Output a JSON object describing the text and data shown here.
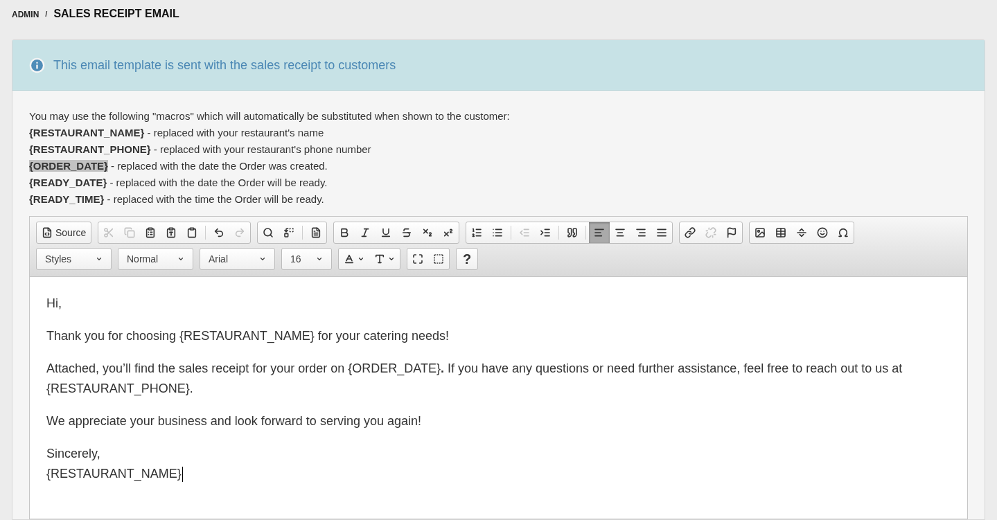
{
  "breadcrumb": {
    "parent": "ADMIN",
    "separator": "/",
    "title": "SALES RECEIPT EMAIL"
  },
  "info": {
    "text": "This email template is sent with the sales receipt to customers"
  },
  "intro": "You may use the following \"macros\" which will automatically be substituted when shown to the customer:",
  "macros": [
    {
      "macro": "{RESTAURANT_NAME}",
      "description": " - replaced with your restaurant's name",
      "highlighted": false
    },
    {
      "macro": "{RESTAURANT_PHONE}",
      "description": " - replaced with your restaurant's phone number",
      "highlighted": false
    },
    {
      "macro": "{ORDER_DATE}",
      "description": " - replaced with the date the Order was created.",
      "highlighted": true
    },
    {
      "macro": "{READY_DATE}",
      "description": " - replaced with the date the Order will be ready.",
      "highlighted": false
    },
    {
      "macro": "{READY_TIME}",
      "description": " - replaced with the time the Order will be ready.",
      "highlighted": false
    }
  ],
  "toolbar": {
    "rows": [
      {
        "groups": [
          {
            "buttons": [
              {
                "kind": "source",
                "label": "Source",
                "disabled": false,
                "selected": false
              }
            ]
          },
          {
            "buttons": [
              {
                "kind": "cut",
                "disabled": true,
                "selected": false
              },
              {
                "kind": "copy",
                "disabled": true,
                "selected": false
              },
              {
                "kind": "paste",
                "disabled": false,
                "selected": false
              },
              {
                "kind": "paste-text",
                "disabled": false,
                "selected": false
              },
              {
                "kind": "paste-word",
                "disabled": false,
                "selected": false
              },
              {
                "kind": "sep"
              },
              {
                "kind": "undo",
                "disabled": false,
                "selected": false
              },
              {
                "kind": "redo",
                "disabled": true,
                "selected": false
              }
            ]
          },
          {
            "buttons": [
              {
                "kind": "find",
                "disabled": false,
                "selected": false
              },
              {
                "kind": "replace",
                "disabled": false,
                "selected": false
              },
              {
                "kind": "sep"
              },
              {
                "kind": "select-all",
                "disabled": false,
                "selected": false
              }
            ]
          },
          {
            "buttons": [
              {
                "kind": "bold",
                "disabled": false,
                "selected": false
              },
              {
                "kind": "italic",
                "disabled": false,
                "selected": false
              },
              {
                "kind": "underline",
                "disabled": false,
                "selected": false
              },
              {
                "kind": "strike",
                "disabled": false,
                "selected": false
              },
              {
                "kind": "subscript",
                "disabled": false,
                "selected": false
              },
              {
                "kind": "superscript",
                "disabled": false,
                "selected": false
              }
            ]
          },
          {
            "buttons": [
              {
                "kind": "numbered-list",
                "disabled": false,
                "selected": false
              },
              {
                "kind": "bulleted-list",
                "disabled": false,
                "selected": false
              },
              {
                "kind": "sep"
              },
              {
                "kind": "outdent",
                "disabled": true,
                "selected": false
              },
              {
                "kind": "indent",
                "disabled": false,
                "selected": false
              },
              {
                "kind": "sep"
              },
              {
                "kind": "quote",
                "disabled": false,
                "selected": false
              },
              {
                "kind": "sep"
              },
              {
                "kind": "align-left",
                "disabled": false,
                "selected": true
              },
              {
                "kind": "align-center",
                "disabled": false,
                "selected": false
              },
              {
                "kind": "align-right",
                "disabled": false,
                "selected": false
              },
              {
                "kind": "justify",
                "disabled": false,
                "selected": false
              }
            ]
          },
          {
            "buttons": [
              {
                "kind": "link",
                "disabled": false,
                "selected": false
              },
              {
                "kind": "unlink",
                "disabled": true,
                "selected": false
              },
              {
                "kind": "anchor",
                "disabled": false,
                "selected": false
              }
            ]
          },
          {
            "buttons": [
              {
                "kind": "image",
                "disabled": false,
                "selected": false
              },
              {
                "kind": "table",
                "disabled": false,
                "selected": false
              },
              {
                "kind": "rule",
                "disabled": false,
                "selected": false
              },
              {
                "kind": "smiley",
                "disabled": false,
                "selected": false
              },
              {
                "kind": "special-char",
                "disabled": false,
                "selected": false
              }
            ]
          }
        ]
      },
      {
        "groups": [
          {
            "kind": "dropdown",
            "label": "Styles"
          },
          {
            "kind": "dropdown",
            "label": "Normal"
          },
          {
            "kind": "dropdown",
            "label": "Arial"
          },
          {
            "kind": "dropdown",
            "label": "16"
          },
          {
            "buttons": [
              {
                "kind": "text-color",
                "disabled": false,
                "selected": false
              },
              {
                "kind": "bg-color",
                "disabled": false,
                "selected": false
              }
            ]
          },
          {
            "buttons": [
              {
                "kind": "maximize",
                "disabled": false,
                "selected": false
              },
              {
                "kind": "show-blocks",
                "disabled": false,
                "selected": false
              }
            ]
          },
          {
            "buttons": [
              {
                "kind": "help",
                "label": "?",
                "disabled": false,
                "selected": false
              }
            ]
          }
        ]
      }
    ]
  },
  "content": [
    {
      "lines": [
        "Hi,"
      ]
    },
    {
      "lines": [
        "Thank you for choosing {RESTAURANT_NAME} for your catering needs!"
      ]
    },
    {
      "lines": [
        "Attached, you’ll find the sales receipt for your order on {ORDER_DATE}**.** If you have any questions or need further assistance, feel free to reach out to us at {RESTAURANT_PHONE}."
      ]
    },
    {
      "lines": [
        "We appreciate your business and look forward to serving you again!"
      ]
    },
    {
      "lines": [
        "Sincerely,",
        "{RESTAURANT_NAME}"
      ],
      "cursor": true
    }
  ]
}
